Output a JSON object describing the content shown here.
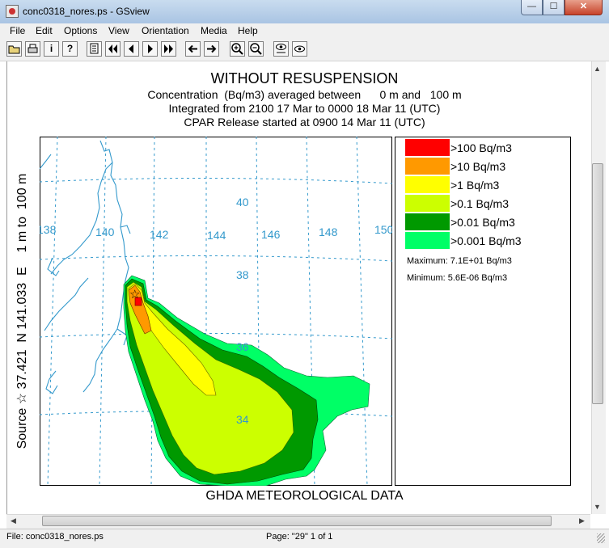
{
  "window": {
    "title": "conc0318_nores.ps - GSview",
    "controls": {
      "minimize": "—",
      "maximize": "☐",
      "close": "✕"
    }
  },
  "menubar": [
    "File",
    "Edit",
    "Options",
    "View",
    "Orientation",
    "Media",
    "Help"
  ],
  "toolbar": {
    "icons": [
      "open-icon",
      "print-icon",
      "info-icon",
      "help-icon",
      "page-select-icon",
      "first-page-icon",
      "previous-page-icon",
      "next-page-icon",
      "last-page-icon",
      "back-icon",
      "forward-icon",
      "zoom-in-icon",
      "zoom-out-icon",
      "view-text-icon",
      "view-eye-icon"
    ],
    "info_label": "i",
    "help_label": "?"
  },
  "plot": {
    "title": "WITHOUT RESUSPENSION",
    "line2": "Concentration  (Bq/m3) averaged between      0 m and   100 m",
    "line3": "Integrated from 2100 17 Mar to 0000 18 Mar 11 (UTC)",
    "line4": "CPAR Release started at 0900 14 Mar 11 (UTC)",
    "ylabel": "Source ☆ 37.421  N 141.033  E    1 m to  100 m",
    "footer": "GHDA METEOROLOGICAL DATA",
    "lon_labels": [
      "138",
      "140",
      "142",
      "144",
      "146",
      "148",
      "150"
    ],
    "lat_labels": [
      "40",
      "38",
      "36",
      "34"
    ],
    "source_marker": "☆"
  },
  "legend": {
    "entries": [
      {
        "label": ">100 Bq/m3",
        "color": "#ff0000"
      },
      {
        "label": ">10 Bq/m3",
        "color": "#ff9900"
      },
      {
        "label": ">1 Bq/m3",
        "color": "#ffff00"
      },
      {
        "label": ">0.1 Bq/m3",
        "color": "#ccff00"
      },
      {
        "label": ">0.01 Bq/m3",
        "color": "#009900"
      },
      {
        "label": ">0.001 Bq/m3",
        "color": "#00ff66"
      }
    ],
    "maximum": "Maximum: 7.1E+01 Bq/m3",
    "minimum": "Minimum: 5.6E-06 Bq/m3"
  },
  "statusbar": {
    "file": "File: conc0318_nores.ps",
    "page": "Page: \"29\"  1 of 1"
  },
  "colors": {
    "grid": "#3399cc",
    "coast": "#3399cc"
  }
}
